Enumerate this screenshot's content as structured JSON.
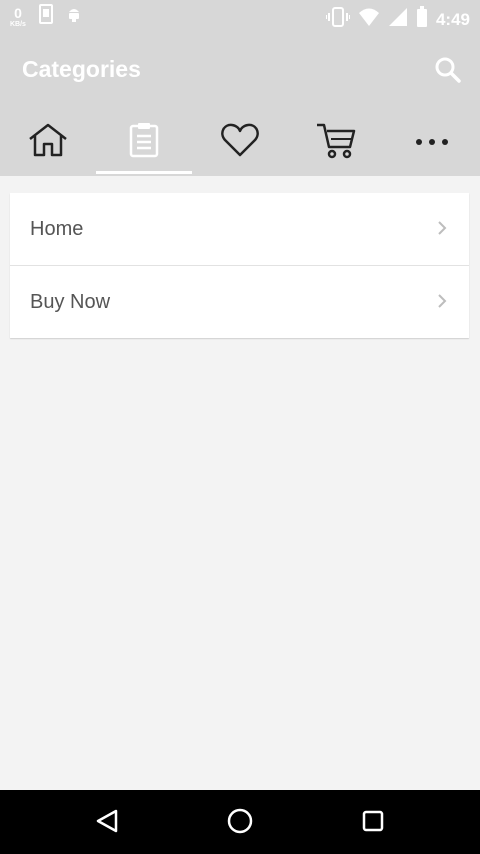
{
  "status_bar": {
    "net_speed_value": "0",
    "net_speed_unit": "KB/s",
    "time": "4:49",
    "icons": [
      "image-icon",
      "android-icon",
      "vibrate-icon",
      "wifi-icon",
      "signal-icon",
      "battery-icon"
    ]
  },
  "app_bar": {
    "title": "Categories",
    "search_icon": "search-icon"
  },
  "tabs": [
    {
      "icon": "home-icon",
      "active": false
    },
    {
      "icon": "clipboard-icon",
      "active": true
    },
    {
      "icon": "heart-icon",
      "active": false
    },
    {
      "icon": "cart-icon",
      "active": false
    },
    {
      "icon": "more-icon",
      "active": false
    }
  ],
  "category_list": [
    {
      "label": "Home"
    },
    {
      "label": "Buy Now"
    }
  ],
  "nav_bar": {
    "icons": [
      "back-icon",
      "home-circle-icon",
      "recents-icon"
    ]
  },
  "colors": {
    "app_bar_bg": "#d7d7d7",
    "page_bg": "#f3f3f3",
    "card_bg": "#ffffff",
    "row_text": "#555555",
    "nav_bar_bg": "#000000"
  }
}
